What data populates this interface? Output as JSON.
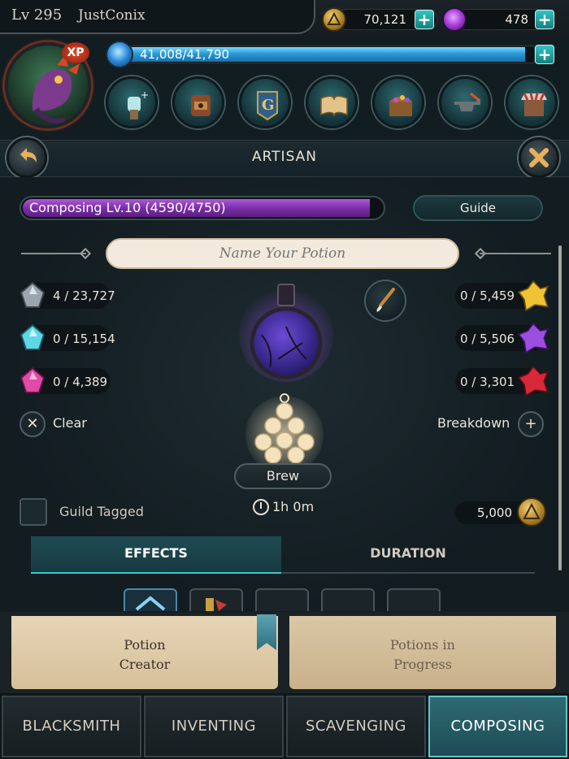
{
  "player": {
    "level": "Lv 295",
    "name": "JustConix"
  },
  "currencies": {
    "gold": {
      "value": "70,121",
      "icon": "gold-coin-icon"
    },
    "gems": {
      "value": "478",
      "icon": "purple-gem-icon"
    }
  },
  "xp": {
    "badge": "XP",
    "text": "41,008/41,790",
    "progress": 0.981
  },
  "quick_icons": [
    "fist-icon",
    "backpack-icon",
    "guild-banner-icon",
    "spellbook-icon",
    "treasure-chest-icon",
    "anvil-icon",
    "shop-icon"
  ],
  "header": {
    "title": "ARTISAN"
  },
  "composing": {
    "label": "Composing Lv.10 (4590/4750)",
    "progress": 0.966
  },
  "guide_label": "Guide",
  "name_field": {
    "placeholder": "Name Your Potion",
    "value": ""
  },
  "ingredients_left": [
    {
      "icon": "grey-crystal-icon",
      "count": "4 / 23,727",
      "color": "#9aa5ad"
    },
    {
      "icon": "cyan-crystal-icon",
      "count": "0 / 15,154",
      "color": "#5ed6e6"
    },
    {
      "icon": "pink-crystal-icon",
      "count": "0 / 4,389",
      "color": "#e04aa8"
    }
  ],
  "ingredients_right": [
    {
      "icon": "gold-crystal-icon",
      "count": "0 / 5,459",
      "color": "#f1c233"
    },
    {
      "icon": "purple-crystal-icon",
      "count": "0 / 5,506",
      "color": "#9b4ee0"
    },
    {
      "icon": "red-crystal-icon",
      "count": "0 / 3,301",
      "color": "#d8283a"
    }
  ],
  "actions": {
    "clear": "Clear",
    "breakdown": "Breakdown",
    "brew": "Brew",
    "duration_time": "1h 0m"
  },
  "guild_tagged": {
    "label": "Guild Tagged",
    "checked": false
  },
  "cost": {
    "value": "5,000"
  },
  "tabs": {
    "effects": "EFFECTS",
    "duration": "DURATION",
    "active": "effects"
  },
  "sub_tabs": {
    "creator": [
      "Potion",
      "Creator"
    ],
    "progress": [
      "Potions in",
      "Progress"
    ]
  },
  "nav": {
    "blacksmith": "BLACKSMITH",
    "inventing": "INVENTING",
    "scavenging": "SCAVENGING",
    "composing": "COMPOSING",
    "active": "composing"
  },
  "colors": {
    "accent": "#39c9c9",
    "composing_bar": "#7a2fa9",
    "xp_bar": "#2a9ad6",
    "parchment": "#e6d5b5"
  }
}
